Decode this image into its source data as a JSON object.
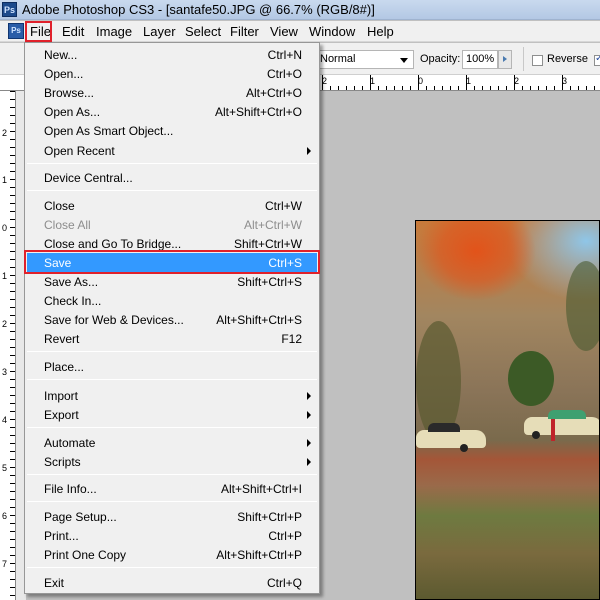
{
  "window": {
    "app_badge": "Ps",
    "title": "Adobe Photoshop CS3 - [santafe50.JPG @ 66.7% (RGB/8#)]"
  },
  "menubar": {
    "items": [
      "File",
      "Edit",
      "Image",
      "Layer",
      "Select",
      "Filter",
      "View",
      "Window",
      "Help"
    ],
    "active": "File"
  },
  "options_bar": {
    "mode": "Normal",
    "opacity_label": "Opacity:",
    "opacity_value": "100%",
    "reverse_label": "Reverse",
    "reverse_checked": false,
    "dither_checked": true
  },
  "rulers": {
    "top_labels": [
      "2",
      "1",
      "0",
      "1",
      "2",
      "3"
    ],
    "left_labels": [
      "2",
      "1",
      "0",
      "1",
      "2",
      "3",
      "4",
      "5",
      "6",
      "7"
    ]
  },
  "file_menu": {
    "items": [
      {
        "label": "New...",
        "shortcut": "Ctrl+N"
      },
      {
        "label": "Open...",
        "shortcut": "Ctrl+O"
      },
      {
        "label": "Browse...",
        "shortcut": "Alt+Ctrl+O"
      },
      {
        "label": "Open As...",
        "shortcut": "Alt+Shift+Ctrl+O"
      },
      {
        "label": "Open As Smart Object...",
        "shortcut": ""
      },
      {
        "label": "Open Recent",
        "shortcut": "",
        "submenu": true
      },
      {
        "label": "Device Central...",
        "shortcut": ""
      },
      {
        "label": "Close",
        "shortcut": "Ctrl+W"
      },
      {
        "label": "Close All",
        "shortcut": "Alt+Ctrl+W",
        "disabled": true
      },
      {
        "label": "Close and Go To Bridge...",
        "shortcut": "Shift+Ctrl+W"
      },
      {
        "label": "Save",
        "shortcut": "Ctrl+S",
        "selected": true
      },
      {
        "label": "Save As...",
        "shortcut": "Shift+Ctrl+S"
      },
      {
        "label": "Check In...",
        "shortcut": ""
      },
      {
        "label": "Save for Web & Devices...",
        "shortcut": "Alt+Shift+Ctrl+S"
      },
      {
        "label": "Revert",
        "shortcut": "F12"
      },
      {
        "label": "Place...",
        "shortcut": ""
      },
      {
        "label": "Import",
        "shortcut": "",
        "submenu": true
      },
      {
        "label": "Export",
        "shortcut": "",
        "submenu": true
      },
      {
        "label": "Automate",
        "shortcut": "",
        "submenu": true
      },
      {
        "label": "Scripts",
        "shortcut": "",
        "submenu": true
      },
      {
        "label": "File Info...",
        "shortcut": "Alt+Shift+Ctrl+I"
      },
      {
        "label": "Page Setup...",
        "shortcut": "Shift+Ctrl+P"
      },
      {
        "label": "Print...",
        "shortcut": "Ctrl+P"
      },
      {
        "label": "Print One Copy",
        "shortcut": "Alt+Shift+Ctrl+P"
      },
      {
        "label": "Exit",
        "shortcut": "Ctrl+Q"
      }
    ]
  },
  "colors": {
    "highlight_box": "#e0212b",
    "menu_selection": "#3399ff"
  }
}
